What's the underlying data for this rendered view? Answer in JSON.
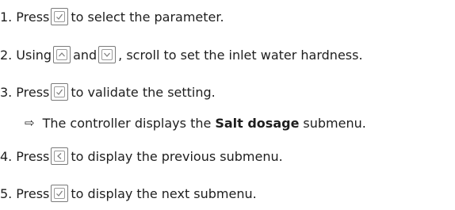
{
  "steps": [
    {
      "num": "1.",
      "before": "Press",
      "key1": "validate-key",
      "after": "to select the parameter."
    },
    {
      "num": "2.",
      "before": "Using",
      "key1": "up-key",
      "between": "and",
      "key2": "down-key",
      "after": ", scroll to set the inlet water hardness."
    },
    {
      "num": "3.",
      "before": "Press",
      "key1": "validate-key",
      "after": "to validate the setting."
    },
    {
      "num": "4.",
      "before": "Press",
      "key1": "back-key",
      "after": "to display the previous submenu."
    },
    {
      "num": "5.",
      "before": "Press",
      "key1": "validate-key",
      "after": "to display the next submenu."
    }
  ],
  "result": {
    "arrow": "⇨",
    "before": "The controller displays the",
    "bold": "Salt dosage",
    "after": "submenu."
  }
}
